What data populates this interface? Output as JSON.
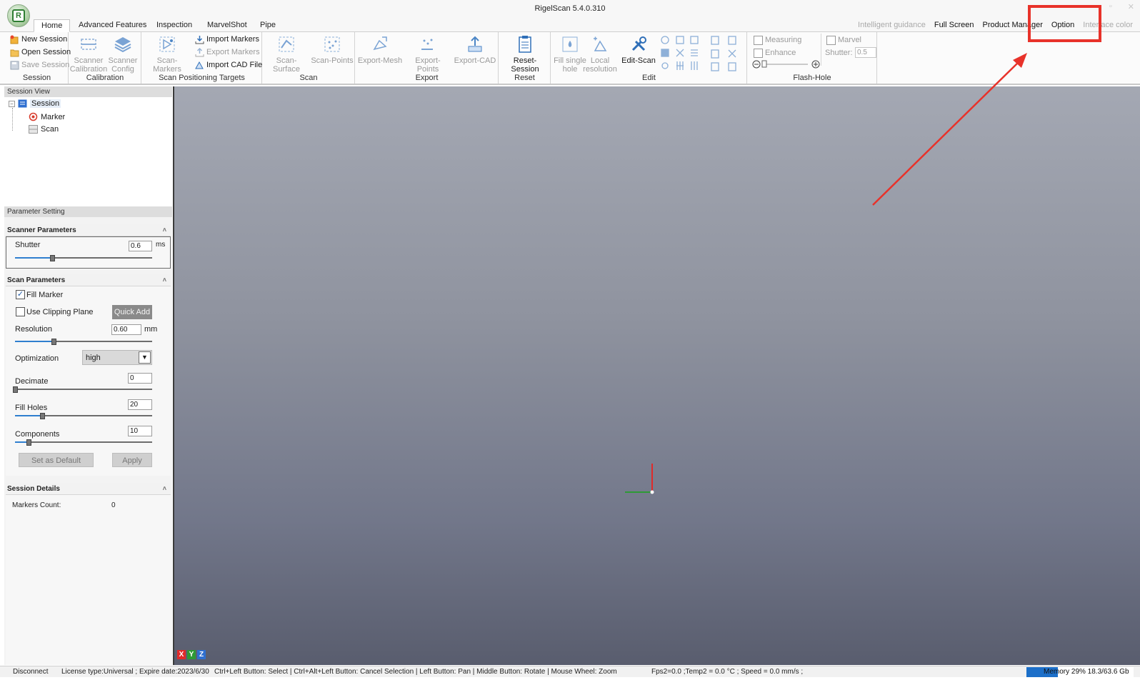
{
  "window": {
    "title": "RigelScan 5.4.0.310",
    "controls": [
      "–",
      "▫",
      "✕"
    ]
  },
  "tabs": [
    "Home",
    "Advanced Features",
    "Inspection",
    "MarvelShot",
    "Pipe"
  ],
  "active_tab": "Home",
  "right_menu": {
    "intelligent_guidance": "Intelligent guidance",
    "full_screen": "Full Screen",
    "product_manager": "Product Manager",
    "option": "Option",
    "interface_color": "Interface color"
  },
  "ribbon": {
    "session": {
      "label": "Session",
      "new_session": "New Session",
      "open_session": "Open Session",
      "save_session": "Save Session"
    },
    "calibration": {
      "label": "Calibration",
      "scanner_calibration": [
        "Scanner",
        "Calibration"
      ],
      "scanner_config": [
        "Scanner",
        "Config"
      ]
    },
    "positioning": {
      "label": "Scan Positioning Targets",
      "scan_markers": "Scan-Markers",
      "import_markers": "Import Markers",
      "export_markers": "Export Markers",
      "import_cad": "Import CAD File"
    },
    "scan": {
      "label": "Scan",
      "scan_surface": "Scan-Surface",
      "scan_points": "Scan-Points"
    },
    "export": {
      "label": "Export",
      "export_mesh": "Export-Mesh",
      "export_points": "Export-Points",
      "export_cad": "Export-CAD"
    },
    "reset": {
      "label": "Reset",
      "reset_session": "Reset-Session"
    },
    "edit": {
      "label": "Edit",
      "fill_single_hole": [
        "Fill single",
        "hole"
      ],
      "local_resolution": [
        "Local",
        "resolution"
      ],
      "edit_scan": "Edit-Scan"
    },
    "flash_hole": {
      "label": "Flash-Hole",
      "measuring": "Measuring",
      "enhance": "Enhance",
      "marvel": "Marvel",
      "shutter_label": "Shutter:",
      "shutter_value": "0.5"
    }
  },
  "session_view": {
    "title": "Session View",
    "root": "Session",
    "children": [
      "Marker",
      "Scan"
    ]
  },
  "parameter_setting": {
    "title": "Parameter Setting",
    "scanner_parameters": {
      "title": "Scanner Parameters",
      "shutter_label": "Shutter",
      "shutter_value": "0.6",
      "shutter_unit": "ms",
      "shutter_level": 0.27
    },
    "scan_parameters": {
      "title": "Scan Parameters",
      "fill_marker": "Fill Marker",
      "fill_marker_checked": true,
      "use_clipping_plane": "Use Clipping Plane",
      "use_clipping_plane_checked": false,
      "quick_add": "Quick Add",
      "resolution_label": "Resolution",
      "resolution_value": "0.60",
      "resolution_unit": "mm",
      "resolution_level": 0.28,
      "optimization_label": "Optimization",
      "optimization_value": "high",
      "decimate_label": "Decimate",
      "decimate_value": "0",
      "decimate_level": 0.0,
      "fill_holes_label": "Fill Holes",
      "fill_holes_value": "20",
      "fill_holes_level": 0.2,
      "components_label": "Components",
      "components_value": "10",
      "components_level": 0.1,
      "set_default": "Set as Default",
      "apply": "Apply"
    },
    "session_details": {
      "title": "Session Details",
      "markers_count_label": "Markers Count:",
      "markers_count_value": "0"
    }
  },
  "viewport": {
    "axes_labels": [
      "X",
      "Y",
      "Z"
    ],
    "axis_colors": {
      "x": "#e02a2a",
      "y": "#2e9a36",
      "z": "#2f6fd0"
    }
  },
  "status_bar": {
    "connection": "Disconnect",
    "license": "License type:Universal ;  Expire date:2023/6/30",
    "hints": "Ctrl+Left Button: Select | Ctrl+Alt+Left Button: Cancel Selection | Left Button: Pan | Middle Button: Rotate | Mouse Wheel: Zoom",
    "telemetry": "Fps2=0.0 ;Temp2 = 0.0 °C ;   Speed = 0.0 mm/s ;",
    "memory_text": "Memory 29% 18.3/63.6 Gb",
    "memory_percent": 29
  },
  "annotation": {
    "color": "#e8322a"
  }
}
